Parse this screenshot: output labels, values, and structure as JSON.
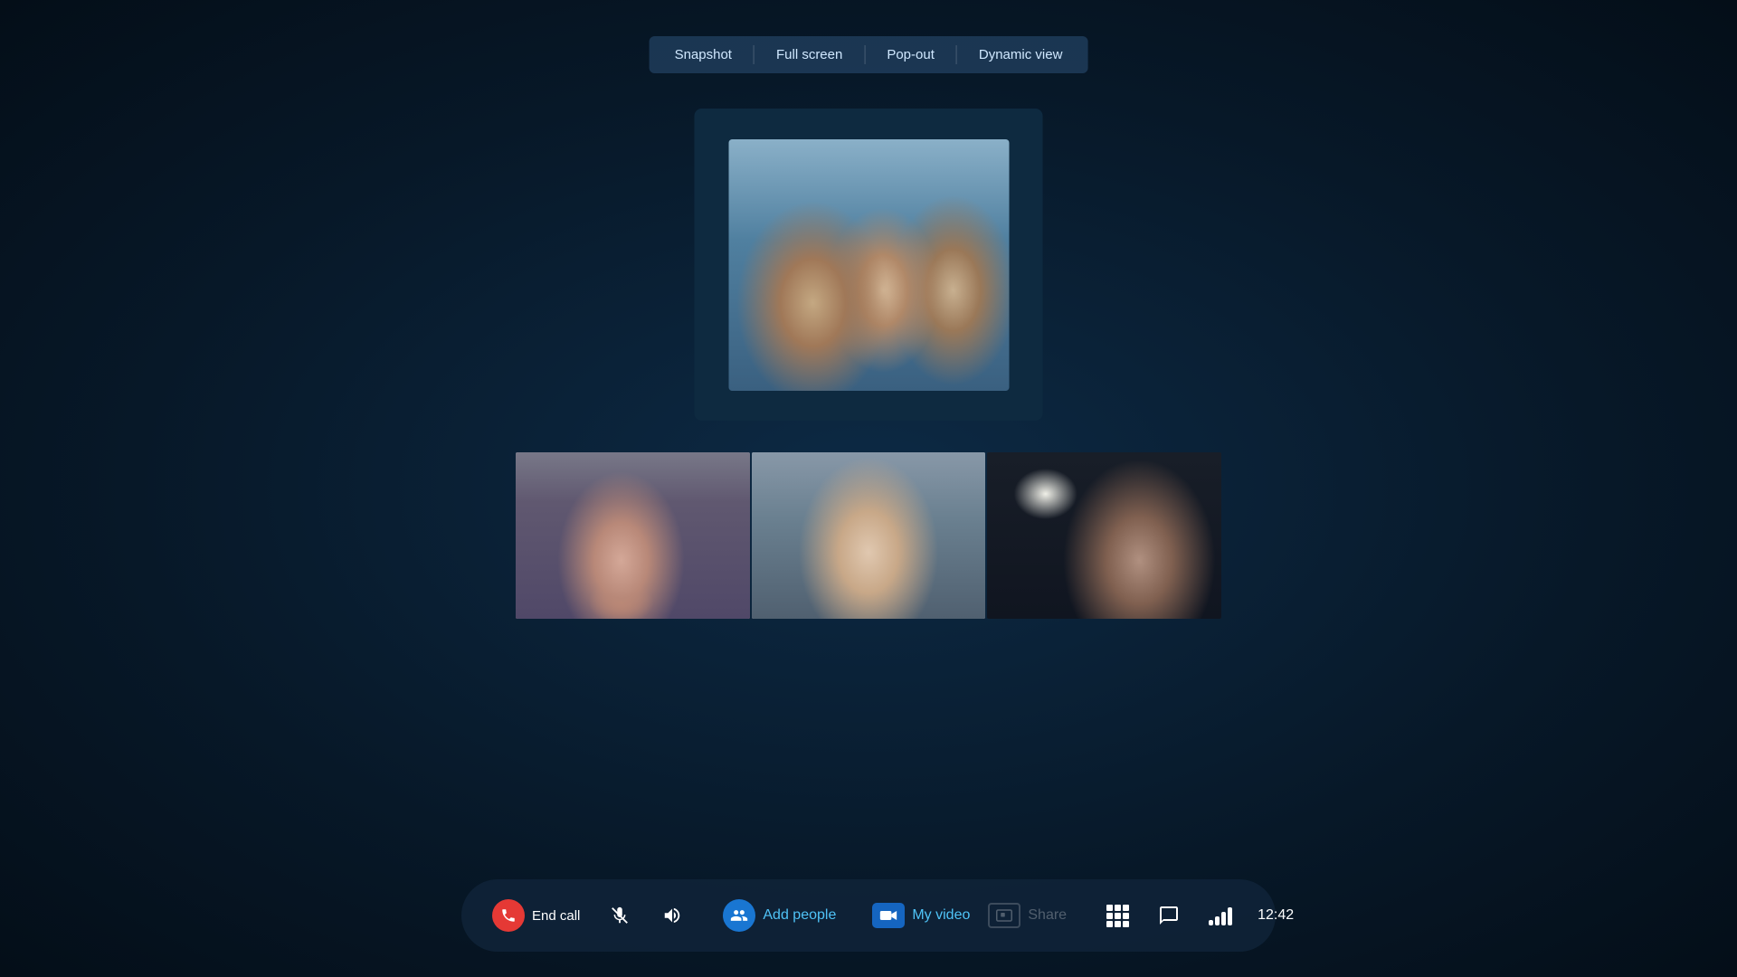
{
  "toolbar": {
    "snapshot_label": "Snapshot",
    "fullscreen_label": "Full screen",
    "popout_label": "Pop-out",
    "dynamicview_label": "Dynamic view"
  },
  "bottom_bar": {
    "end_call_label": "End call",
    "add_people_label": "Add people",
    "my_video_label": "My video",
    "share_label": "Share",
    "time": "12:42"
  }
}
